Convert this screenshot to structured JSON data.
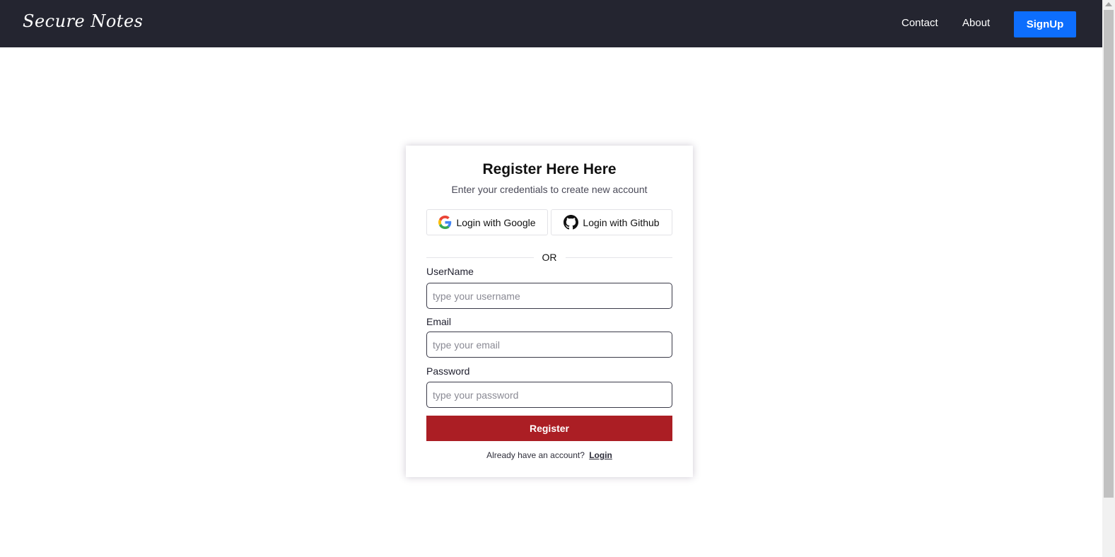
{
  "navbar": {
    "brand": "Secure Notes",
    "links": [
      {
        "label": "Contact"
      },
      {
        "label": "About"
      }
    ],
    "signup_label": "SignUp"
  },
  "card": {
    "title": "Register Here Here",
    "subtitle": "Enter your credentials to create new account",
    "google_label": "Login with Google",
    "github_label": "Login with Github",
    "divider_text": "OR",
    "fields": {
      "username": {
        "label": "UserName",
        "placeholder": "type your username",
        "value": ""
      },
      "email": {
        "label": "Email",
        "placeholder": "type your email",
        "value": ""
      },
      "password": {
        "label": "Password",
        "placeholder": "type your password",
        "value": ""
      }
    },
    "register_label": "Register",
    "account_prompt": "Already have an account?",
    "login_label": "Login"
  },
  "colors": {
    "navbar_bg": "#242530",
    "signup_bg": "#0d6efd",
    "register_bg": "#ab1e24"
  }
}
